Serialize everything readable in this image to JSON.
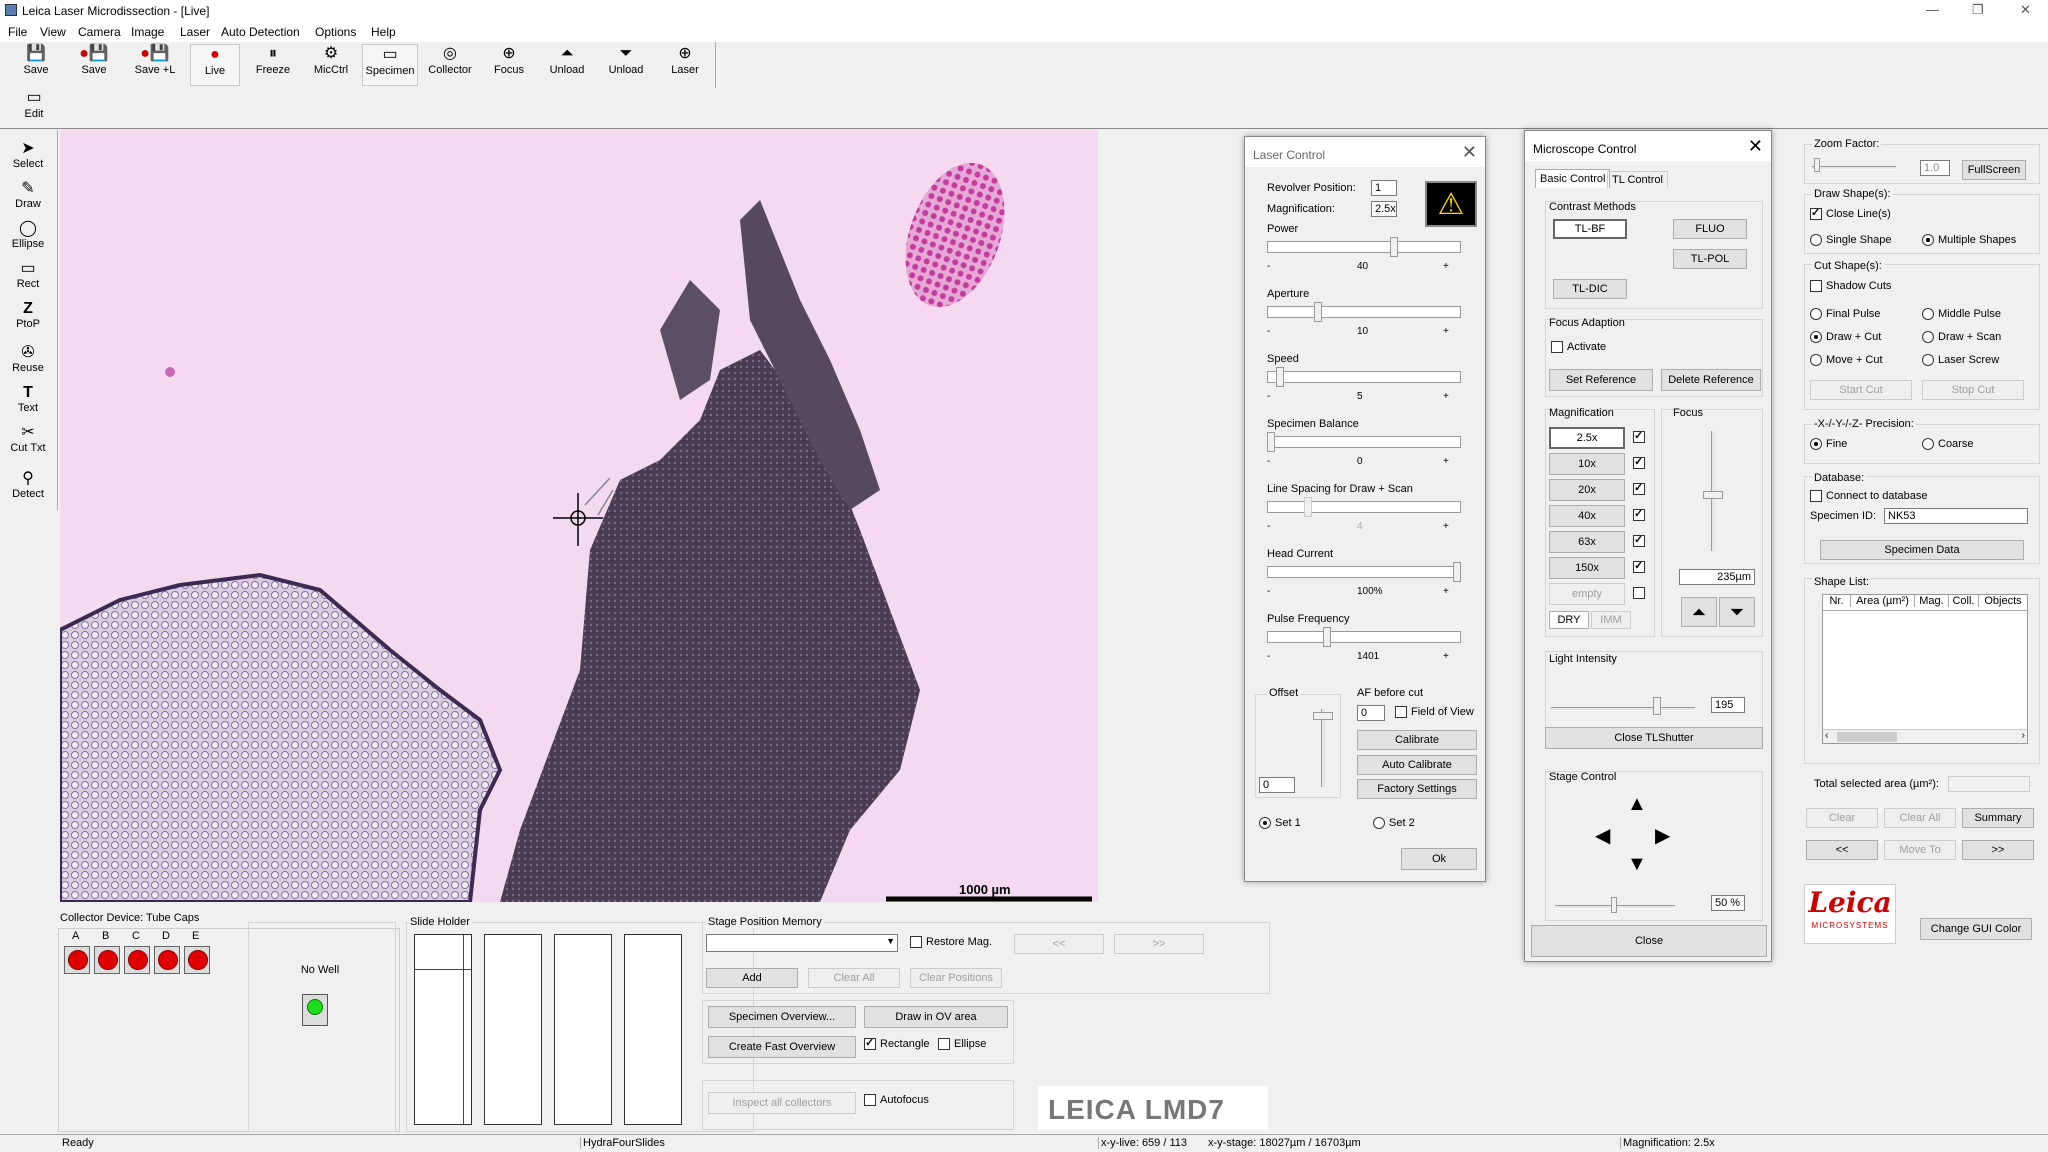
{
  "app": {
    "title": "Leica Laser Microdissection - [Live]",
    "controls": {
      "min": "—",
      "max": "❐",
      "close": "✕"
    }
  },
  "menu": [
    "File",
    "View",
    "Camera",
    "Image",
    "Laser",
    "Auto Detection",
    "Options",
    "Help"
  ],
  "toolbar": [
    {
      "label": "Save",
      "icon": "save-icon",
      "glyph": "💾"
    },
    {
      "label": "Save",
      "icon": "record-save-icon",
      "glyph": "●💾"
    },
    {
      "label": "Save +L",
      "icon": "record-save-l-icon",
      "glyph": "●💾"
    },
    {
      "label": "Live",
      "icon": "live-icon",
      "glyph": "●"
    },
    {
      "label": "Freeze",
      "icon": "freeze-icon",
      "glyph": "⏸"
    },
    {
      "label": "MicCtrl",
      "icon": "mic-control-icon",
      "glyph": "⚙"
    },
    {
      "label": "Specimen",
      "icon": "specimen-icon",
      "glyph": "▭"
    },
    {
      "label": "Collector",
      "icon": "collector-icon",
      "glyph": "◎"
    },
    {
      "label": "Focus",
      "icon": "focus-icon",
      "glyph": "⊕"
    },
    {
      "label": "Unload",
      "icon": "unload-up-icon",
      "glyph": "⏶"
    },
    {
      "label": "Unload",
      "icon": "unload-down-icon",
      "glyph": "⏷"
    },
    {
      "label": "Laser",
      "icon": "laser-icon",
      "glyph": "⊕"
    }
  ],
  "edit": {
    "label": "Edit",
    "icon": "edit-icon",
    "glyph": "▭"
  },
  "tools": [
    {
      "label": "Select",
      "icon": "select-arrow-icon",
      "glyph": "➤"
    },
    {
      "label": "Draw",
      "icon": "draw-pen-icon",
      "glyph": "✎"
    },
    {
      "label": "Ellipse",
      "icon": "ellipse-icon",
      "glyph": "◯"
    },
    {
      "label": "Rect",
      "icon": "rect-icon",
      "glyph": "▭"
    },
    {
      "label": "PtoP",
      "icon": "point-to-point-icon",
      "glyph": "Z"
    },
    {
      "label": "Reuse",
      "icon": "reuse-icon",
      "glyph": "✇"
    },
    {
      "label": "Text",
      "icon": "text-icon",
      "glyph": "T"
    },
    {
      "label": "Cut Txt",
      "icon": "cut-text-icon",
      "glyph": "✂"
    },
    {
      "label": "Detect",
      "icon": "detect-icon",
      "glyph": "⚲"
    }
  ],
  "image": {
    "scale_label": "1000 µm"
  },
  "laser": {
    "title": "Laser Control",
    "revolver_label": "Revolver Position:",
    "revolver": "1",
    "mag_label": "Magnification:",
    "mag": "2.5x",
    "sliders": [
      {
        "label": "Power",
        "value": "40",
        "level": 0.66
      },
      {
        "label": "Aperture",
        "value": "10",
        "level": 0.25
      },
      {
        "label": "Speed",
        "value": "5",
        "level": 0.05
      },
      {
        "label": "Specimen Balance",
        "value": "0",
        "level": 0.0
      },
      {
        "label": "Line Spacing for Draw + Scan",
        "value": "4",
        "level": 0.2,
        "disabled": true
      },
      {
        "label": "Head Current",
        "value": "100%",
        "level": 1.0
      },
      {
        "label": "Pulse Frequency",
        "value": "1401",
        "level": 0.3
      }
    ],
    "minus": "-",
    "plus": "+",
    "offset_label": "Offset",
    "offset": "0",
    "af_label": "AF before cut",
    "af_value": "0",
    "fov_label": "Field of View",
    "calibrate": "Calibrate",
    "auto_calibrate": "Auto Calibrate",
    "factory": "Factory Settings",
    "set1": "Set 1",
    "set2": "Set 2",
    "ok": "Ok"
  },
  "mic": {
    "title": "Microscope Control",
    "tabs": [
      "Basic Control",
      "TL Control"
    ],
    "contrast_label": "Contrast Methods",
    "tlbf": "TL-BF",
    "fluo": "FLUO",
    "tlpol": "TL-POL",
    "tldic": "TL-DIC",
    "focus_adapt_label": "Focus Adaption",
    "activate": "Activate",
    "set_ref": "Set Reference",
    "del_ref": "Delete Reference",
    "mag_label": "Magnification",
    "mags": [
      "2.5x",
      "10x",
      "20x",
      "40x",
      "63x",
      "150x",
      "empty"
    ],
    "dry": "DRY",
    "imm": "IMM",
    "focus_label": "Focus",
    "focus_value": "235µm",
    "light_label": "Light Intensity",
    "light": "195",
    "light_level": 0.75,
    "shutter": "Close TLShutter",
    "stage_label": "Stage Control",
    "stage_speed": "50 %",
    "close": "Close"
  },
  "right": {
    "zoom_label": "Zoom Factor:",
    "zoom": "1.0",
    "fullscreen": "FullScreen",
    "draw_shape_label": "Draw Shape(s):",
    "close_lines": "Close Line(s)",
    "single": "Single Shape",
    "multiple": "Multiple Shapes",
    "cut_shape_label": "Cut Shape(s):",
    "shadow": "Shadow Cuts",
    "final_pulse": "Final Pulse",
    "middle_pulse": "Middle Pulse",
    "draw_cut": "Draw + Cut",
    "draw_scan": "Draw + Scan",
    "move_cut": "Move + Cut",
    "laser_screw": "Laser Screw",
    "start_cut": "Start Cut",
    "stop_cut": "Stop Cut",
    "precision_label": "-X-/-Y-/-Z- Precision:",
    "fine": "Fine",
    "coarse": "Coarse",
    "db_label": "Database:",
    "connect_db": "Connect to database",
    "specimen_id_label": "Specimen ID:",
    "specimen_id": "NK53",
    "specimen_data": "Specimen Data",
    "shape_list_label": "Shape List:",
    "columns": [
      "Nr.",
      "Area (µm²)",
      "Mag.",
      "Coll.",
      "Objects"
    ],
    "total_label": "Total selected area (µm²):",
    "clear": "Clear",
    "clear_all": "Clear All",
    "summary": "Summary",
    "prev": "<<",
    "move_to": "Move To",
    "next": ">>",
    "leica": "Leica",
    "microsystems": "MICROSYSTEMS",
    "change_gui": "Change GUI Color"
  },
  "collector": {
    "label": "Collector Device: Tube Caps",
    "caps": [
      "A",
      "B",
      "C",
      "D",
      "E"
    ],
    "no_well": "No Well"
  },
  "slide": {
    "label": "Slide Holder"
  },
  "stagemem": {
    "label": "Stage Position Memory",
    "restore": "Restore Mag.",
    "prev": "<<",
    "next": ">>",
    "add": "Add",
    "clear_all": "Clear All",
    "clear_pos": "Clear Positions"
  },
  "overview": {
    "spec_ov": "Specimen Overview...",
    "draw_ov": "Draw in OV area",
    "fast_ov": "Create Fast Overview",
    "rect": "Rectangle",
    "ellipse": "Ellipse",
    "inspect": "Inspect all collectors",
    "autofocus": "Autofocus"
  },
  "brand": "LEICA LMD7",
  "status": {
    "ready": "Ready",
    "slides": "HydraFourSlides",
    "xy": "x-y-live: 659 / 113",
    "stage": "x-y-stage: 18027µm / 16703µm",
    "mag": "Magnification: 2.5x"
  }
}
